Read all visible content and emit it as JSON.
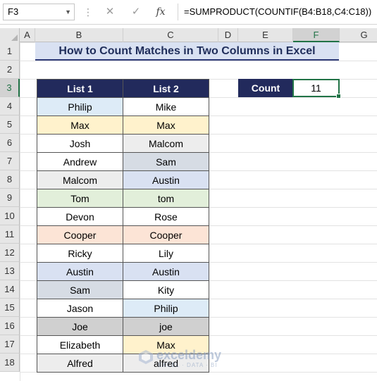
{
  "formula_bar": {
    "name_box": "F3",
    "formula": "=SUMPRODUCT(COUNTIF(B4:B18,C4:C18))"
  },
  "columns": [
    "A",
    "B",
    "C",
    "D",
    "E",
    "F",
    "G"
  ],
  "rows": [
    "1",
    "2",
    "3",
    "4",
    "5",
    "6",
    "7",
    "8",
    "9",
    "10",
    "11",
    "12",
    "13",
    "14",
    "15",
    "16",
    "17",
    "18"
  ],
  "active_cell": {
    "column": "F",
    "row": "3"
  },
  "title": "How to Count Matches in Two Columns in Excel",
  "table": {
    "headers": [
      "List 1",
      "List 2"
    ],
    "rows": [
      {
        "list1": "Philip",
        "list2": "Mike",
        "c1": "#ddebf7",
        "c2": "#ffffff"
      },
      {
        "list1": "Max",
        "list2": "Max",
        "c1": "#fff2cc",
        "c2": "#fff2cc"
      },
      {
        "list1": "Josh",
        "list2": "Malcom",
        "c1": "#ffffff",
        "c2": "#ededed"
      },
      {
        "list1": "Andrew",
        "list2": "Sam",
        "c1": "#ffffff",
        "c2": "#d6dce4"
      },
      {
        "list1": "Malcom",
        "list2": "Austin",
        "c1": "#ededed",
        "c2": "#d9e1f2"
      },
      {
        "list1": "Tom",
        "list2": "tom",
        "c1": "#e2efda",
        "c2": "#e2efda"
      },
      {
        "list1": "Devon",
        "list2": "Rose",
        "c1": "#ffffff",
        "c2": "#ffffff"
      },
      {
        "list1": "Cooper",
        "list2": "Cooper",
        "c1": "#fce4d6",
        "c2": "#fce4d6"
      },
      {
        "list1": "Ricky",
        "list2": "Lily",
        "c1": "#ffffff",
        "c2": "#ffffff"
      },
      {
        "list1": "Austin",
        "list2": "Austin",
        "c1": "#d9e1f2",
        "c2": "#d9e1f2"
      },
      {
        "list1": "Sam",
        "list2": "Kity",
        "c1": "#d6dce4",
        "c2": "#ffffff"
      },
      {
        "list1": "Jason",
        "list2": "Philip",
        "c1": "#ffffff",
        "c2": "#ddebf7"
      },
      {
        "list1": "Joe",
        "list2": "joe",
        "c1": "#d0d0d0",
        "c2": "#d0d0d0"
      },
      {
        "list1": "Elizabeth",
        "list2": "Max",
        "c1": "#ffffff",
        "c2": "#fff2cc"
      },
      {
        "list1": "Alfred",
        "list2": "alfred",
        "c1": "#ededed",
        "c2": "#ededed"
      }
    ]
  },
  "count": {
    "label": "Count",
    "value": "11"
  },
  "watermark": {
    "name": "exceldemy",
    "tagline": "EXCEL · DATA · BI"
  },
  "colors": {
    "header_fill": "#222a5c",
    "title_fill": "#d9e1f2",
    "accent": "#217346"
  }
}
